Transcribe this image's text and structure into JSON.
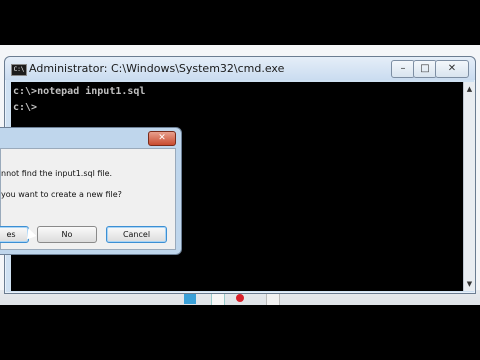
{
  "cmd_window": {
    "title": "Administrator: C:\\Windows\\System32\\cmd.exe",
    "icon_label": "C:\\",
    "controls": {
      "minimize": "–",
      "maximize": "□",
      "close": "✕"
    },
    "lines": [
      "c:\\>notepad input1.sql",
      "c:\\>"
    ]
  },
  "dialog": {
    "close": "✕",
    "message_1": "nnot find the input1.sql file.",
    "message_2": "you want to create a new file?",
    "buttons": {
      "yes": "es",
      "no": "No",
      "cancel": "Cancel"
    }
  },
  "scrollbar": {
    "up": "▲",
    "down": "▼"
  }
}
